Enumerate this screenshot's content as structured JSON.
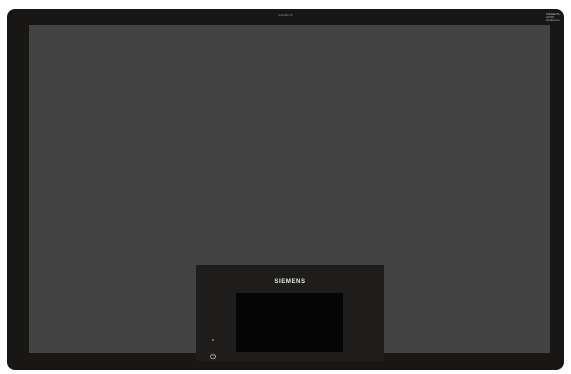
{
  "product": {
    "brand": "SIEMENS",
    "top_brand_text": "SIEMENS",
    "corner_badge_lines": [
      "SIEMENS",
      "iQ700",
      "studioLine"
    ]
  },
  "icons": {
    "power": "power-icon"
  },
  "colors": {
    "frame": "#181716",
    "glass_surface": "#434343",
    "control_panel": "#1e1d1c",
    "display": "#050505",
    "logo": "#e8e8e8"
  }
}
